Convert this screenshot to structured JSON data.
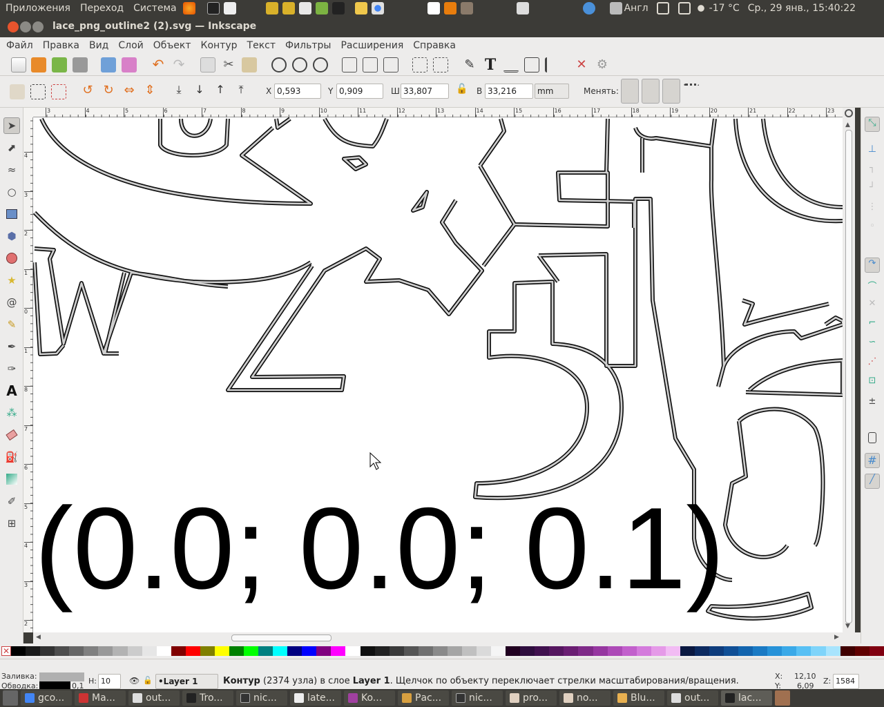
{
  "topbar": {
    "apps": "Приложения",
    "places": "Переход",
    "system": "Система",
    "keyboard": "Англ",
    "weather": "-17 °C",
    "clock": "Ср., 29 янв., 15:40:22"
  },
  "window": {
    "title": "lace_png_outline2 (2).svg — Inkscape"
  },
  "menu": [
    "Файл",
    "Правка",
    "Вид",
    "Слой",
    "Объект",
    "Контур",
    "Текст",
    "Фильтры",
    "Расширения",
    "Справка"
  ],
  "controls": {
    "x_label": "X",
    "x_value": "0,593",
    "y_label": "Y",
    "y_value": "0,909",
    "w_label": "Ш",
    "w_value": "33,807",
    "h_label": "В",
    "h_value": "33,216",
    "unit": "mm",
    "change_label": "Менять:"
  },
  "ruler_top": [
    "3",
    "4",
    "5",
    "6",
    "7",
    "8",
    "9",
    "10",
    "11",
    "12",
    "13",
    "14",
    "15",
    "16",
    "17",
    "18",
    "19",
    "20",
    "21",
    "22",
    "23"
  ],
  "ruler_left": [
    "4",
    "3",
    "2",
    "1",
    "0",
    "1",
    "8",
    "7",
    "6",
    "5",
    "4",
    "3",
    "2"
  ],
  "canvas": {
    "coordinate_text": "(0.0; 0.0; 0.1)",
    "letters": [
      "W",
      "Z",
      "5",
      "f"
    ]
  },
  "status": {
    "fill_label": "Заливка:",
    "stroke_label": "Обводка:",
    "stroke_width": "0,1",
    "opacity_label": "Н:",
    "opacity_value": "10",
    "layer": "•Layer 1",
    "message_bold": "Контур",
    "message_rest": " (2374 узла) в слое ",
    "message_layer": "Layer 1",
    "message_tail": ". Щелчок по объекту переключает стрелки масштабирования/вращения.",
    "cursor_x_label": "X:",
    "cursor_x": "12,10",
    "cursor_y_label": "Y:",
    "cursor_y": "6,09",
    "zoom_label": "Z:",
    "zoom": "1584"
  },
  "taskbar": [
    "gco...",
    "Ma...",
    "out...",
    "Tro...",
    "nic...",
    "late...",
    "Ko...",
    "Рас...",
    "nic...",
    "pro...",
    "no...",
    "Blu...",
    "out...",
    "lac..."
  ],
  "palette_colors": [
    "#000000",
    "#1a1a1a",
    "#333333",
    "#4d4d4d",
    "#666666",
    "#808080",
    "#999999",
    "#b3b3b3",
    "#cccccc",
    "#e6e6e6",
    "#ffffff",
    "#800000",
    "#ff0000",
    "#808000",
    "#ffff00",
    "#008000",
    "#00ff00",
    "#008080",
    "#00ffff",
    "#000080",
    "#0000ff",
    "#800080",
    "#ff00ff",
    "#ffffff",
    "#101010",
    "#222222",
    "#3a3a3a",
    "#555555",
    "#707070",
    "#8a8a8a",
    "#a5a5a5",
    "#c0c0c0",
    "#dadada",
    "#f5f5f5",
    "#200020",
    "#2e0d3e",
    "#40104e",
    "#55165f",
    "#6a1e72",
    "#7f2a88",
    "#9637a0",
    "#ad4ab7",
    "#c260cc",
    "#d47bdc",
    "#e59ae8",
    "#f2bcf4",
    "#0a1840",
    "#0c2a60",
    "#0e3c7c",
    "#104f96",
    "#1264ae",
    "#1a7ac4",
    "#2792d8",
    "#3aa9e8",
    "#58c0f4",
    "#7fd4fa",
    "#a8e4fd",
    "#400000",
    "#600000",
    "#800010"
  ]
}
